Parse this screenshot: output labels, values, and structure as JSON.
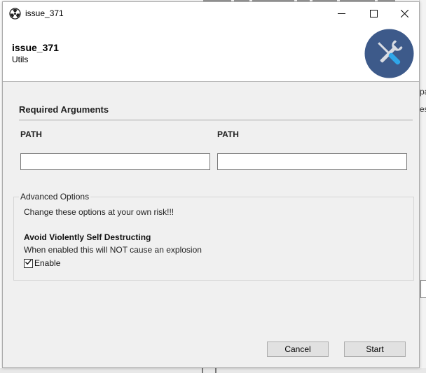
{
  "window": {
    "title": "issue_371",
    "icons": {
      "app": "radiation-icon",
      "minimize": "minimize-icon",
      "maximize": "maximize-icon",
      "close": "close-icon"
    }
  },
  "header": {
    "title": "issue_371",
    "subtitle": "Utils",
    "badge_icon": "tools-icon",
    "badge_color": "#3d5a8a"
  },
  "required": {
    "title": "Required Arguments",
    "fields": [
      {
        "label": "PATH",
        "value": ""
      },
      {
        "label": "PATH",
        "value": ""
      }
    ]
  },
  "advanced": {
    "legend": "Advanced Options",
    "description": "Change these options at your own risk!!!",
    "option": {
      "title": "Avoid Violently Self Destructing",
      "description": "When enabled this will NOT cause an explosion",
      "checkbox_label": "Enable",
      "checked": true
    }
  },
  "footer": {
    "cancel_label": "Cancel",
    "start_label": "Start"
  },
  "background": {
    "right_text_1": "pa",
    "right_text_2": "es"
  }
}
